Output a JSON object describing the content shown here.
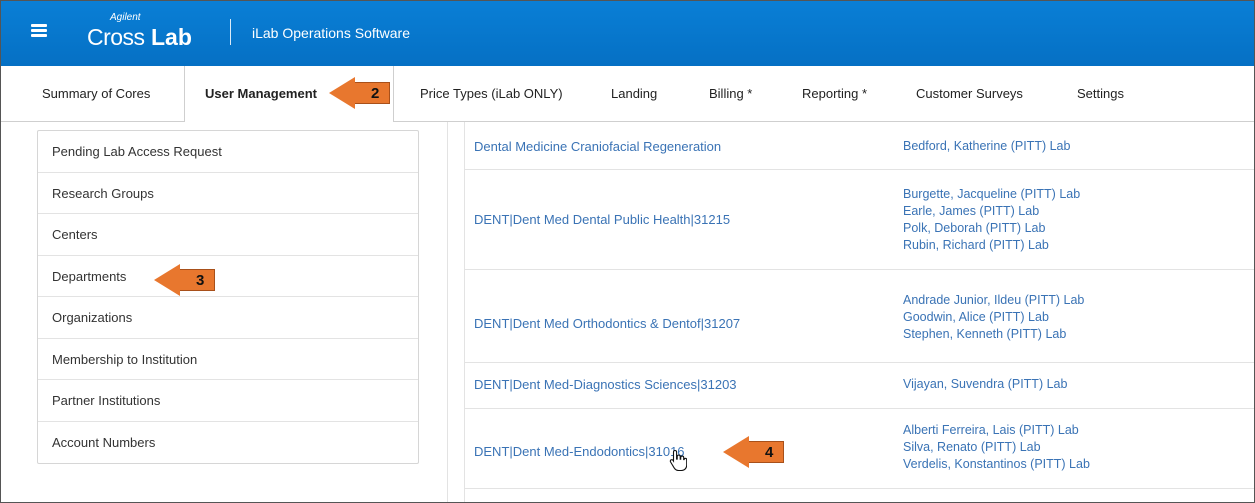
{
  "header": {
    "brand": "Agilent",
    "product_cross": "Cross",
    "product_lab": "Lab",
    "app_name": "iLab Operations Software"
  },
  "tabs": [
    {
      "label": "Summary of Cores"
    },
    {
      "label": "User Management",
      "active": true
    },
    {
      "label": "Price Types (iLab ONLY)"
    },
    {
      "label": "Landing"
    },
    {
      "label": "Billing *"
    },
    {
      "label": "Reporting *"
    },
    {
      "label": "Customer Surveys"
    },
    {
      "label": "Settings"
    }
  ],
  "left_nav": [
    {
      "label": "Pending Lab Access Request"
    },
    {
      "label": "Research Groups"
    },
    {
      "label": "Centers"
    },
    {
      "label": "Departments"
    },
    {
      "label": "Organizations"
    },
    {
      "label": "Membership to Institution"
    },
    {
      "label": "Partner Institutions"
    },
    {
      "label": "Account Numbers"
    }
  ],
  "departments": [
    {
      "name": "Dental Medicine Craniofacial Regeneration",
      "labs": [
        "Bedford, Katherine (PITT) Lab"
      ]
    },
    {
      "name": "DENT|Dent Med Dental Public Health|31215",
      "labs": [
        "Burgette, Jacqueline (PITT) Lab",
        "Earle, James (PITT) Lab",
        "Polk, Deborah (PITT) Lab",
        "Rubin, Richard (PITT) Lab"
      ]
    },
    {
      "name": "DENT|Dent Med Orthodontics & Dentof|31207",
      "labs": [
        "Andrade Junior, Ildeu (PITT) Lab",
        "Goodwin, Alice (PITT) Lab",
        "Stephen, Kenneth (PITT) Lab"
      ]
    },
    {
      "name": "DENT|Dent Med-Diagnostics Sciences|31203",
      "labs": [
        "Vijayan, Suvendra (PITT) Lab"
      ]
    },
    {
      "name": "DENT|Dent Med-Endodontics|31016",
      "labs": [
        "Alberti Ferreira, Lais (PITT) Lab",
        "Silva, Renato (PITT) Lab",
        "Verdelis, Konstantinos (PITT) Lab"
      ]
    }
  ],
  "annotations": [
    {
      "number": "2"
    },
    {
      "number": "3"
    },
    {
      "number": "4"
    }
  ],
  "colors": {
    "header_blue": "#0a7fd6",
    "link_blue": "#3a73b5",
    "callout_orange": "#e8772e"
  },
  "icons": {
    "menu": "hamburger-icon",
    "cursor": "hand-pointer-icon",
    "callout": "left-arrow-callout"
  }
}
